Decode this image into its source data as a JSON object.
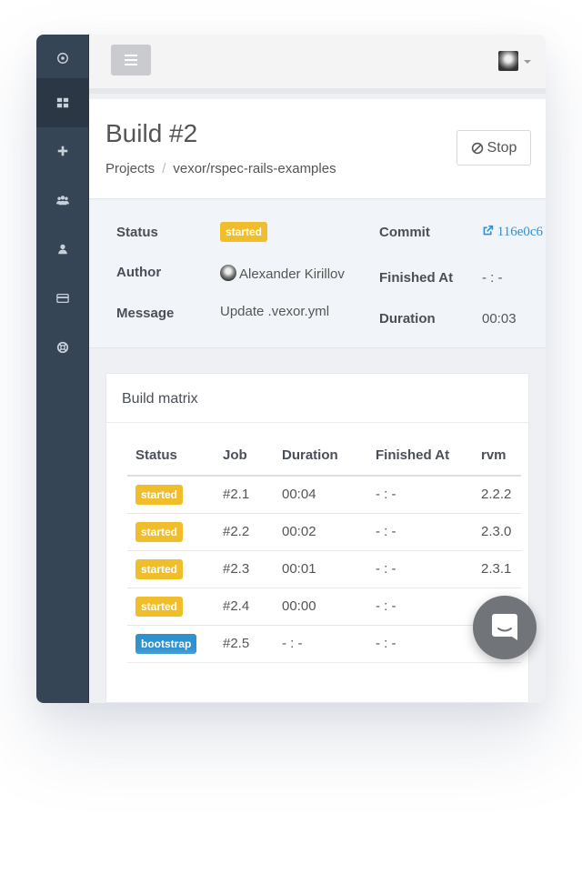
{
  "sidebar": {
    "items": [
      {
        "icon": "dashboard-circle-icon"
      },
      {
        "icon": "grid-icon",
        "active": true
      },
      {
        "icon": "plus-icon"
      },
      {
        "icon": "users-icon"
      },
      {
        "icon": "user-icon"
      },
      {
        "icon": "credit-card-icon"
      },
      {
        "icon": "lifebuoy-icon"
      }
    ]
  },
  "header": {
    "title": "Build #2",
    "breadcrumb": [
      "Projects",
      "vexor/rspec-rails-examples"
    ],
    "stop_label": "Stop"
  },
  "info": {
    "status_label": "Status",
    "status_value": "started",
    "author_label": "Author",
    "author_value": "Alexander Kirillov",
    "message_label": "Message",
    "message_value": "Update .vexor.yml",
    "commit_label": "Commit",
    "commit_value": "116e0c6",
    "finished_label": "Finished At",
    "finished_value": "- : -",
    "duration_label": "Duration",
    "duration_value": "00:03"
  },
  "matrix": {
    "title": "Build matrix",
    "columns": [
      "Status",
      "Job",
      "Duration",
      "Finished At",
      "rvm"
    ],
    "rows": [
      {
        "status": "started",
        "job": "#2.1",
        "duration": "00:04",
        "finished": "- : -",
        "rvm": "2.2.2"
      },
      {
        "status": "started",
        "job": "#2.2",
        "duration": "00:02",
        "finished": "- : -",
        "rvm": "2.3.0"
      },
      {
        "status": "started",
        "job": "#2.3",
        "duration": "00:01",
        "finished": "- : -",
        "rvm": "2.3.1"
      },
      {
        "status": "started",
        "job": "#2.4",
        "duration": "00:00",
        "finished": "- : -",
        "rvm": ""
      },
      {
        "status": "bootstrap",
        "job": "#2.5",
        "duration": "- : -",
        "finished": "- : -",
        "rvm": ""
      }
    ]
  },
  "colors": {
    "sidebar": "#364556",
    "started": "#f0bd2b",
    "bootstrap": "#2f92d0",
    "link": "#2f8fd8"
  }
}
